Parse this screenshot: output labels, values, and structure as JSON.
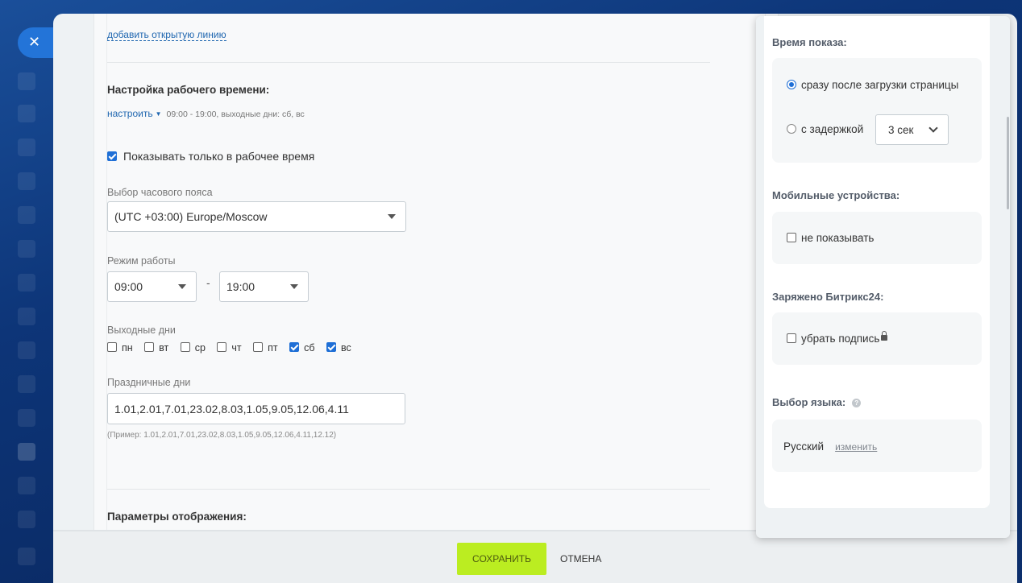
{
  "close_icon": "✕",
  "form": {
    "add_open_line_link": "добавить открытую линию",
    "work_time_title": "Настройка рабочего времени:",
    "setup_link": "настроить",
    "setup_desc": "09:00 - 19:00, выходные дни: сб, вс",
    "show_work_time_label": "Показывать только в рабочее время",
    "show_work_time_checked": true,
    "timezone_label": "Выбор часового пояса",
    "timezone_value": "(UTC +03:00) Europe/Moscow",
    "work_mode_label": "Режим работы",
    "time_from": "09:00",
    "time_separator": "-",
    "time_to": "19:00",
    "weekends_label": "Выходные дни",
    "days": [
      {
        "label": "пн",
        "checked": false
      },
      {
        "label": "вт",
        "checked": false
      },
      {
        "label": "ср",
        "checked": false
      },
      {
        "label": "чт",
        "checked": false
      },
      {
        "label": "пт",
        "checked": false
      },
      {
        "label": "сб",
        "checked": true
      },
      {
        "label": "вс",
        "checked": true
      }
    ],
    "holidays_label": "Праздничные дни",
    "holidays_value": "1.01,2.01,7.01,23.02,8.03,1.05,9.05,12.06,4.11",
    "holidays_hint": "(Пример: 1.01,2.01,7.01,23.02,8.03,1.05,9.05,12.06,4.11,12.12)",
    "display_params_title": "Параметры отображения:"
  },
  "footer": {
    "save_label": "СОХРАНИТЬ",
    "cancel_label": "ОТМЕНА"
  },
  "popup": {
    "show_time_title": "Время показа:",
    "option_immediately": "сразу после загрузки страницы",
    "option_delay": "с задержкой",
    "delay_value": "3 сек",
    "mobile_title": "Мобильные устройства:",
    "mobile_option": "не показывать",
    "powered_title": "Заряжено Битрикс24:",
    "powered_option": "убрать подпись",
    "language_title": "Выбор языка:",
    "help_icon": "?",
    "language_value": "Русский",
    "language_change_link": "изменить"
  },
  "colors": {
    "accent_blue": "#1f6fd6",
    "save_button": "#bbed21",
    "link": "#2067b0"
  }
}
